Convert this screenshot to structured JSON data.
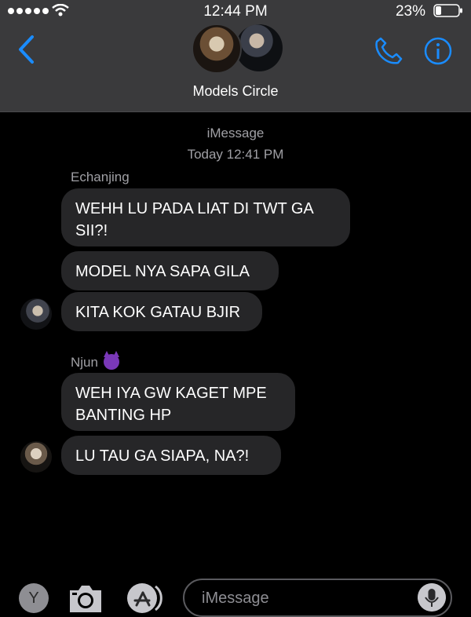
{
  "status_bar": {
    "time": "12:44 PM",
    "battery_percent": "23%"
  },
  "header": {
    "title": "Models Circle",
    "back_icon": "chevron-left-icon",
    "call_icon": "phone-icon",
    "info_icon": "info-icon"
  },
  "conversation": {
    "service": "iMessage",
    "timestamp": "Today 12:41 PM",
    "groups": [
      {
        "sender": "Echanjing",
        "messages": [
          "WEHH LU PADA LIAT DI TWT GA SII?!",
          "MODEL NYA SAPA GILA",
          "KITA KOK GATAU BJIR"
        ]
      },
      {
        "sender": "Njun",
        "sender_emoji": "smiling-devil-emoji",
        "messages": [
          "WEH IYA GW KAGET MPE BANTING HP",
          "LU TAU GA SIAPA, NA?!"
        ]
      }
    ]
  },
  "input_bar": {
    "left_button_label": "Y",
    "placeholder": "iMessage",
    "icons": [
      "camera-icon",
      "app-store-icon",
      "microphone-icon"
    ]
  },
  "colors": {
    "accent": "#1a8cff",
    "header_bg": "#3a3a3c",
    "bubble_bg": "#262628",
    "background": "#000000"
  }
}
